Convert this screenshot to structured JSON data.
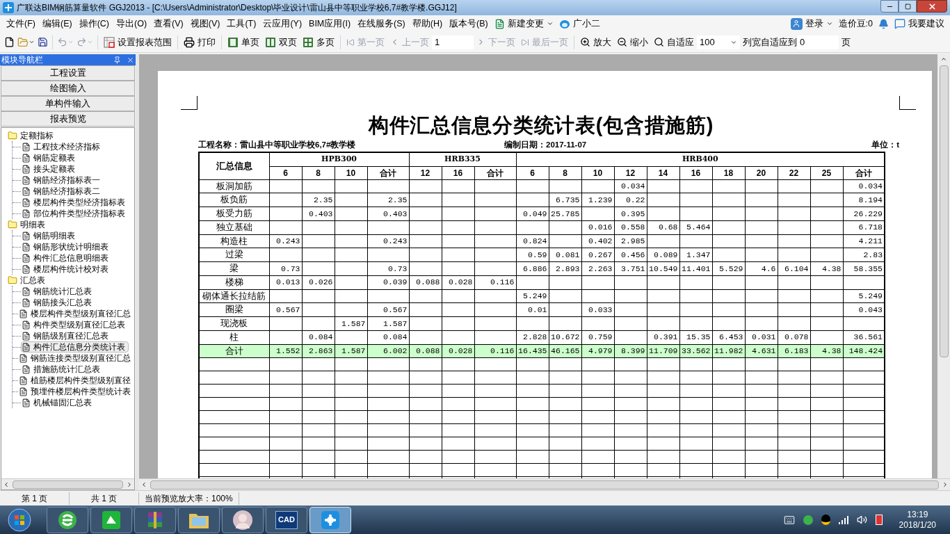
{
  "window": {
    "title": "广联达BIM钢筋算量软件 GGJ2013 - [C:\\Users\\Administrator\\Desktop\\毕业设计\\雷山县中等职业学校6,7#教学楼.GGJ12]"
  },
  "menu": [
    "文件(F)",
    "编辑(E)",
    "操作(C)",
    "导出(O)",
    "查看(V)",
    "视图(V)",
    "工具(T)",
    "云应用(Y)",
    "BIM应用(I)",
    "在线服务(S)",
    "帮助(H)",
    "版本号(B)"
  ],
  "menu_extra": {
    "change": "新建变更",
    "assistant": "广小二",
    "login": "登录",
    "beans": "造价豆:0",
    "suggest": "我要建议"
  },
  "toolbar": {
    "undo_disabled": true,
    "redo_disabled": true,
    "report_range": "设置报表范围",
    "print": "打印",
    "views": [
      {
        "label": "单页",
        "disabled": false
      },
      {
        "label": "双页",
        "disabled": false
      },
      {
        "label": "多页",
        "disabled": false
      }
    ],
    "nav_before": [
      {
        "label": "第一页",
        "disabled": true
      },
      {
        "label": "上一页",
        "disabled": true
      }
    ],
    "page_value": "1",
    "nav_after": [
      {
        "label": "下一页",
        "disabled": true
      },
      {
        "label": "最后一页",
        "disabled": true
      }
    ],
    "zoom_in": "放大",
    "zoom_out": "缩小",
    "fit": "自适应",
    "zoom_value": "100",
    "col_fit_label": "列宽自适应到",
    "col_fit_value": "0",
    "page_unit": "页"
  },
  "nav": {
    "title": "模块导航栏",
    "sections": [
      "工程设置",
      "绘图输入",
      "单构件输入",
      "报表预览"
    ],
    "tree": [
      {
        "label": "定额指标",
        "expanded": true,
        "children": [
          {
            "label": "工程技术经济指标",
            "selected": false
          },
          {
            "label": "钢筋定额表",
            "selected": false
          },
          {
            "label": "接头定额表",
            "selected": false
          },
          {
            "label": "钢筋经济指标表一",
            "selected": false
          },
          {
            "label": "钢筋经济指标表二",
            "selected": false
          },
          {
            "label": "楼层构件类型经济指标表",
            "selected": false
          },
          {
            "label": "部位构件类型经济指标表",
            "selected": false
          }
        ]
      },
      {
        "label": "明细表",
        "expanded": true,
        "children": [
          {
            "label": "钢筋明细表",
            "selected": false
          },
          {
            "label": "钢筋形状统计明细表",
            "selected": false
          },
          {
            "label": "构件汇总信息明细表",
            "selected": false
          },
          {
            "label": "楼层构件统计校对表",
            "selected": false
          }
        ]
      },
      {
        "label": "汇总表",
        "expanded": true,
        "children": [
          {
            "label": "钢筋统计汇总表",
            "selected": false
          },
          {
            "label": "钢筋接头汇总表",
            "selected": false
          },
          {
            "label": "楼层构件类型级别直径汇总",
            "selected": false
          },
          {
            "label": "构件类型级别直径汇总表",
            "selected": false
          },
          {
            "label": "钢筋级别直径汇总表",
            "selected": false
          },
          {
            "label": "构件汇总信息分类统计表",
            "selected": true
          },
          {
            "label": "钢筋连接类型级别直径汇总",
            "selected": false
          },
          {
            "label": "措施筋统计汇总表",
            "selected": false
          },
          {
            "label": "植筋楼层构件类型级别直径",
            "selected": false
          },
          {
            "label": "预埋件楼层构件类型统计表",
            "selected": false
          },
          {
            "label": "机械锚固汇总表",
            "selected": false
          }
        ]
      }
    ]
  },
  "report": {
    "title": "构件汇总信息分类统计表(包含措施筋)",
    "project": "工程名称：雷山县中等职业学校6,7#教学楼",
    "date": "编制日期：2017-11-07",
    "unit": "单位：t",
    "corner_header": "汇总信息",
    "groups": [
      {
        "name": "HPB300",
        "columns": [
          "6",
          "8",
          "10",
          "合计"
        ]
      },
      {
        "name": "HRB335",
        "columns": [
          "12",
          "16",
          "合计"
        ]
      },
      {
        "name": "HRB400",
        "columns": [
          "6",
          "8",
          "10",
          "12",
          "14",
          "16",
          "18",
          "20",
          "22",
          "25",
          "合计"
        ]
      }
    ],
    "rows": [
      {
        "kind": "data",
        "label": "板洞加筋",
        "cells": [
          null,
          null,
          null,
          null,
          null,
          null,
          null,
          null,
          null,
          null,
          "0.034",
          null,
          null,
          null,
          null,
          null,
          null,
          "0.034"
        ]
      },
      {
        "kind": "data",
        "label": "板负筋",
        "cells": [
          null,
          "2.35",
          null,
          "2.35",
          null,
          null,
          null,
          null,
          "6.735",
          "1.239",
          "0.22",
          null,
          null,
          null,
          null,
          null,
          null,
          "8.194"
        ]
      },
      {
        "kind": "data",
        "label": "板受力筋",
        "cells": [
          null,
          "0.403",
          null,
          "0.403",
          null,
          null,
          null,
          "0.049",
          "25.785",
          null,
          "0.395",
          null,
          null,
          null,
          null,
          null,
          null,
          "26.229"
        ]
      },
      {
        "kind": "data",
        "label": "独立基础",
        "cells": [
          null,
          null,
          null,
          null,
          null,
          null,
          null,
          null,
          null,
          "0.016",
          "0.558",
          "0.68",
          "5.464",
          null,
          null,
          null,
          null,
          "6.718"
        ]
      },
      {
        "kind": "data",
        "label": "构造柱",
        "cells": [
          "0.243",
          null,
          null,
          "0.243",
          null,
          null,
          null,
          "0.824",
          null,
          "0.402",
          "2.985",
          null,
          null,
          null,
          null,
          null,
          null,
          "4.211"
        ]
      },
      {
        "kind": "data",
        "label": "过梁",
        "cells": [
          null,
          null,
          null,
          null,
          null,
          null,
          null,
          "0.59",
          "0.081",
          "0.267",
          "0.456",
          "0.089",
          "1.347",
          null,
          null,
          null,
          null,
          "2.83"
        ]
      },
      {
        "kind": "data",
        "label": "梁",
        "cells": [
          "0.73",
          null,
          null,
          "0.73",
          null,
          null,
          null,
          "6.886",
          "2.893",
          "2.263",
          "3.751",
          "10.549",
          "11.401",
          "5.529",
          "4.6",
          "6.104",
          "4.38",
          "58.355"
        ]
      },
      {
        "kind": "data",
        "label": "楼梯",
        "cells": [
          "0.013",
          "0.026",
          null,
          "0.039",
          "0.088",
          "0.028",
          "0.116",
          null,
          null,
          null,
          null,
          null,
          null,
          null,
          null,
          null,
          null,
          null
        ]
      },
      {
        "kind": "data",
        "label": "砌体通长拉结筋",
        "cells": [
          null,
          null,
          null,
          null,
          null,
          null,
          null,
          "5.249",
          null,
          null,
          null,
          null,
          null,
          null,
          null,
          null,
          null,
          "5.249"
        ]
      },
      {
        "kind": "data",
        "label": "圈梁",
        "cells": [
          "0.567",
          null,
          null,
          "0.567",
          null,
          null,
          null,
          "0.01",
          null,
          "0.033",
          null,
          null,
          null,
          null,
          null,
          null,
          null,
          "0.043"
        ]
      },
      {
        "kind": "data",
        "label": "现浇板",
        "cells": [
          null,
          null,
          "1.587",
          "1.587",
          null,
          null,
          null,
          null,
          null,
          null,
          null,
          null,
          null,
          null,
          null,
          null,
          null,
          null
        ]
      },
      {
        "kind": "data",
        "label": "柱",
        "cells": [
          null,
          "0.084",
          null,
          "0.084",
          null,
          null,
          null,
          "2.828",
          "10.672",
          "0.759",
          null,
          "0.391",
          "15.35",
          "6.453",
          "0.031",
          "0.078",
          null,
          "36.561"
        ]
      },
      {
        "kind": "total",
        "label": "合计",
        "cells": [
          "1.552",
          "2.863",
          "1.587",
          "6.002",
          "0.088",
          "0.028",
          "0.116",
          "16.435",
          "46.165",
          "4.979",
          "8.399",
          "11.709",
          "33.562",
          "11.982",
          "4.631",
          "6.183",
          "4.38",
          "148.424"
        ]
      }
    ]
  },
  "status_bar": [
    "第 1 页",
    "共 1 页",
    "当前预览放大率：100%"
  ],
  "taskbar": {
    "apps": [
      {
        "kind": "browser",
        "selected": false
      },
      {
        "kind": "green",
        "selected": false
      },
      {
        "kind": "archive",
        "selected": false
      },
      {
        "kind": "folder",
        "selected": false
      },
      {
        "kind": "avatar",
        "selected": false
      },
      {
        "kind": "cad",
        "label": "CAD",
        "selected": false
      },
      {
        "kind": "glodon",
        "selected": true
      }
    ],
    "time": "13:19",
    "date": "2018/1/20"
  }
}
